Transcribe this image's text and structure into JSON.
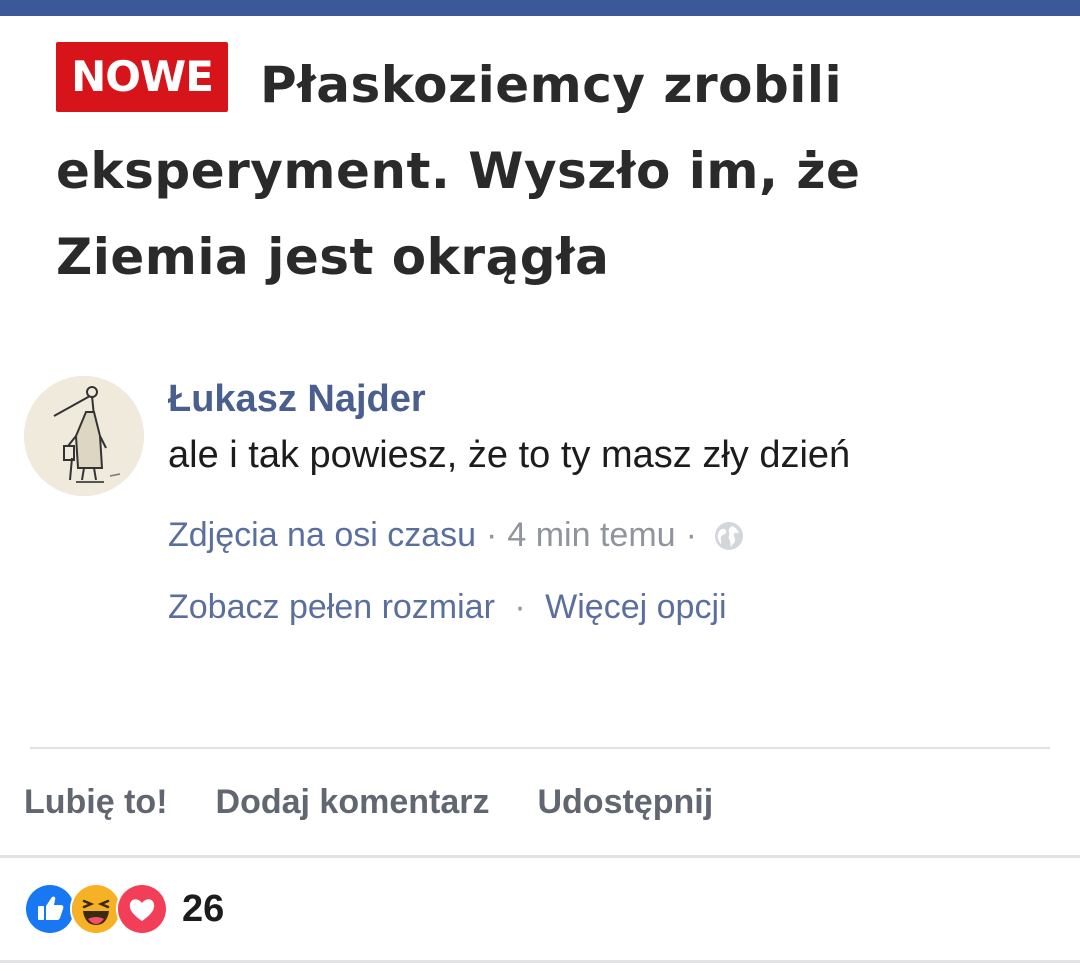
{
  "post_image": {
    "badge": "NOWE",
    "headline": "Płaskoziemcy zrobili eksperyment. Wyszło im, że Ziemia jest okrągła"
  },
  "comment": {
    "author": "Łukasz Najder",
    "text": "ale i tak powiesz, że to ty masz zły dzień",
    "album_link": "Zdjęcia na osi czasu",
    "timestamp": "4 min temu",
    "privacy_icon": "globe-icon",
    "separator": "·",
    "full_size_link": "Zobacz pełen rozmiar",
    "more_options_link": "Więcej opcji"
  },
  "actions": {
    "like": "Lubię to!",
    "comment": "Dodaj komentarz",
    "share": "Udostępnij"
  },
  "reactions": {
    "icons": [
      "like-icon",
      "haha-icon",
      "love-icon"
    ],
    "count": "26"
  },
  "colors": {
    "top_bar": "#3b5998",
    "badge": "#d8141b",
    "link": "#4b5f8e",
    "like": "#1877f2",
    "love": "#f33e58",
    "haha": "#f7b125"
  }
}
